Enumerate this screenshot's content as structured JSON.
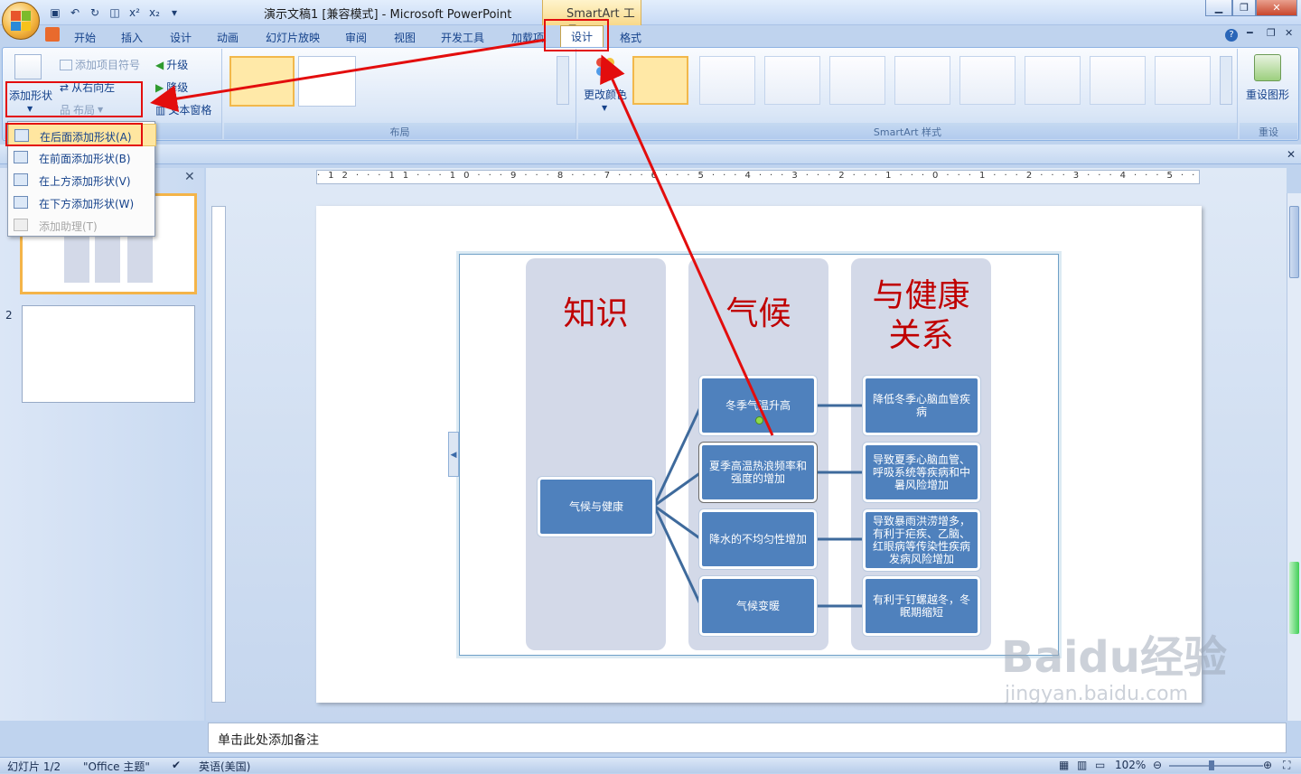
{
  "window": {
    "title": "演示文稿1 [兼容模式] - Microsoft PowerPoint",
    "context_tool": "SmartArt 工具"
  },
  "tabs": [
    "开始",
    "插入",
    "设计",
    "动画",
    "幻灯片放映",
    "审阅",
    "视图",
    "开发工具",
    "加载项",
    "设计",
    "格式"
  ],
  "ribbon": {
    "create_graphic": {
      "add_bullet": "添加项目符号",
      "right_to_left": "从右向左",
      "layout": "布局",
      "promote": "升级",
      "demote": "降级",
      "text_pane": "文本窗格",
      "add_shape": "添加形状"
    },
    "layouts_label": "布局",
    "change_colors": "更改颜色",
    "styles_label": "SmartArt 样式",
    "reset_graphic": "重设图形",
    "reset_label": "重设"
  },
  "dropdown": {
    "items": [
      "在后面添加形状(A)",
      "在前面添加形状(B)",
      "在上方添加形状(V)",
      "在下方添加形状(W)",
      "添加助理(T)"
    ]
  },
  "slides_pane": {
    "slide2_number": "2"
  },
  "smartart": {
    "col_titles": [
      "知识",
      "气候",
      "与健康\n关系"
    ],
    "root": "气候与健康",
    "middle": [
      "冬季气温升高",
      "夏季高温热浪频率和强度的增加",
      "降水的不均匀性增加",
      "气候变暖"
    ],
    "right": [
      "降低冬季心脑血管疾病",
      "导致夏季心脑血管、呼吸系统等疾病和中暑风险增加",
      "导致暴雨洪涝增多，有利于疟疾、乙脑、红眼病等传染性疾病发病风险增加",
      "有利于钉螺越冬，冬眠期缩短"
    ]
  },
  "notes_placeholder": "单击此处添加备注",
  "status": {
    "slide": "幻灯片 1/2",
    "theme": "\"Office 主题\"",
    "language": "英语(美国)",
    "zoom": "102%"
  },
  "watermark": {
    "brand": "Baidu经验",
    "url": "jingyan.baidu.com"
  },
  "colors": {
    "accent_red": "#e30d0d",
    "node_blue": "#4f81bd",
    "column_gray": "#d3d9e8",
    "title_red": "#c00000"
  }
}
